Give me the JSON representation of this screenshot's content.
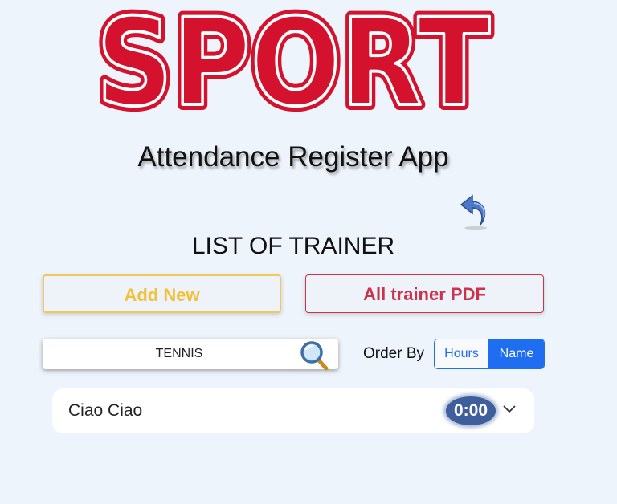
{
  "logo": {
    "text": "SPORT",
    "color": "#d5122e"
  },
  "app_title": "Attendance Register App",
  "back_icon": "undo-arrow-icon",
  "section_title": "LIST OF TRAINER",
  "buttons": {
    "add_new": "Add New",
    "all_trainer_pdf": "All trainer PDF"
  },
  "search": {
    "value": "TENNIS",
    "icon": "magnifier-icon"
  },
  "order_by": {
    "label": "Order By",
    "options": [
      "Hours",
      "Name"
    ],
    "selected": "Name"
  },
  "trainers": [
    {
      "name": "Ciao Ciao",
      "hours": "0:00"
    }
  ],
  "colors": {
    "accent": "#1f6ef2",
    "add_new": "#f1c13a",
    "pdf": "#c9334b",
    "badge": "#3e5f9c"
  }
}
